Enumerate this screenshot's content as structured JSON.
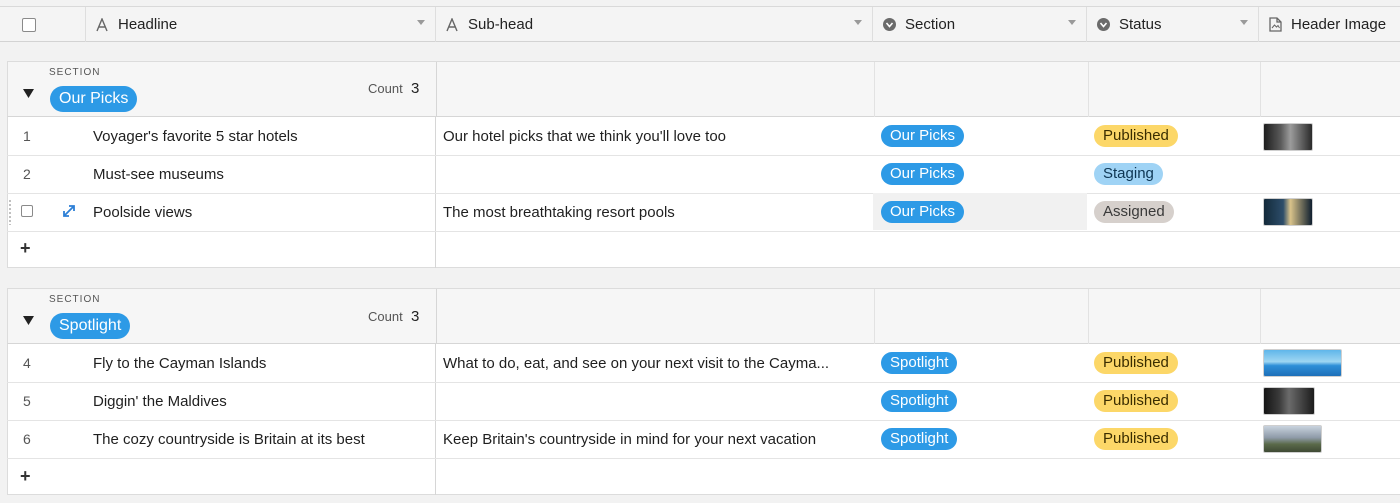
{
  "columns": [
    {
      "label": "Headline",
      "icon": "text-type-icon"
    },
    {
      "label": "Sub-head",
      "icon": "text-type-icon"
    },
    {
      "label": "Section",
      "icon": "single-select-icon"
    },
    {
      "label": "Status",
      "icon": "single-select-icon"
    },
    {
      "label": "Header Image",
      "icon": "attachment-icon"
    }
  ],
  "groups": [
    {
      "field_label": "SECTION",
      "name": "Our Picks",
      "count_label": "Count",
      "count": "3",
      "rows": [
        {
          "num": "1",
          "headline": "Voyager's favorite 5 star hotels",
          "subhead": "Our hotel picks that we think you'll love too",
          "section": "Our Picks",
          "status": "Published"
        },
        {
          "num": "2",
          "headline": "Must-see museums",
          "subhead": "",
          "section": "Our Picks",
          "status": "Staging"
        },
        {
          "num": "",
          "headline": "Poolside views",
          "subhead": "The most breathtaking resort pools",
          "section": "Our Picks",
          "status": "Assigned"
        }
      ]
    },
    {
      "field_label": "SECTION",
      "name": "Spotlight",
      "count_label": "Count",
      "count": "3",
      "rows": [
        {
          "num": "4",
          "headline": "Fly to the Cayman Islands",
          "subhead": "What to do, eat, and see on your next visit to the Cayma...",
          "section": "Spotlight",
          "status": "Published"
        },
        {
          "num": "5",
          "headline": "Diggin' the Maldives",
          "subhead": "",
          "section": "Spotlight",
          "status": "Published"
        },
        {
          "num": "6",
          "headline": "The cozy countryside is Britain at its best",
          "subhead": "Keep Britain's countryside in mind for your next vacation",
          "section": "Spotlight",
          "status": "Published"
        }
      ]
    }
  ],
  "add_row": "+",
  "colors": {
    "section_pill": "#2d9ae6",
    "published": "#fcd768",
    "staging": "#9fd3f5",
    "assigned": "#d6d0cc"
  }
}
